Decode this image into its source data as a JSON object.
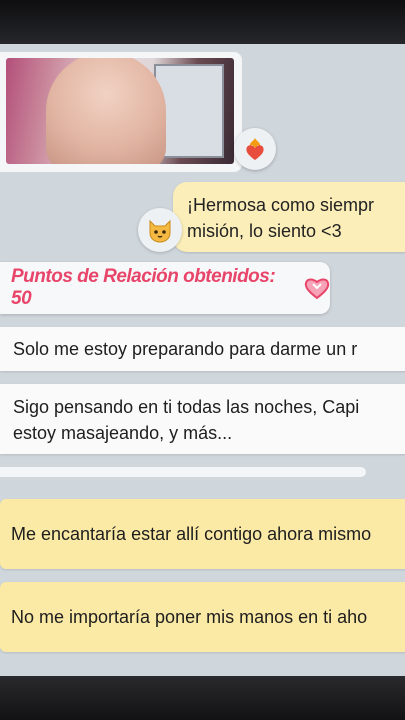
{
  "chat": {
    "photo_message": {
      "reaction_icon": "flaming-heart-icon"
    },
    "sent_message": {
      "text": "¡Hermosa como siempr\nmisión, lo siento <3",
      "avatar_icon": "cat-face-icon"
    },
    "relationship_points": {
      "label": "Puntos de Relación obtenidos: 50",
      "icon": "heart-badge-icon",
      "color": "#e8456a"
    },
    "received_messages": [
      {
        "text": "Solo me estoy preparando para darme un r"
      },
      {
        "text": "Sigo pensando en ti todas las noches, Capi\nestoy masajeando, y más..."
      }
    ],
    "reply_options": [
      {
        "text": "Me encantaría estar allí contigo ahora mismo"
      },
      {
        "text": "No me importaría poner mis manos en ti aho"
      }
    ]
  },
  "colors": {
    "chat_background": "#cfd6dc",
    "sent_bubble": "#fbeeb8",
    "reply_option": "#fbe9a6",
    "points_text": "#e8456a"
  }
}
